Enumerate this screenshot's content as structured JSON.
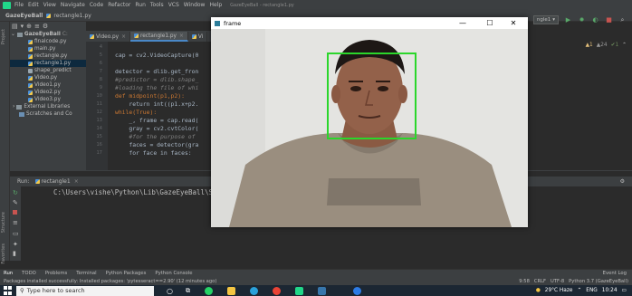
{
  "menubar": {
    "items": [
      "File",
      "Edit",
      "View",
      "Navigate",
      "Code",
      "Refactor",
      "Run",
      "Tools",
      "VCS",
      "Window",
      "Help"
    ],
    "window_title": "GazeEyeBall - rectangle1.py"
  },
  "navbar": {
    "project": "GazeEyeBall",
    "file": "rectangle1.py"
  },
  "toolbar": {
    "run_config": "ngle1"
  },
  "project_panel": {
    "header": "Project",
    "root": "GazeEyeBall",
    "root_suffix": "C:",
    "items": [
      {
        "label": "finalcode.py"
      },
      {
        "label": "main.py"
      },
      {
        "label": "rectangle.py"
      },
      {
        "label": "rectangle1.py",
        "selected": true
      },
      {
        "label": "shape_predict"
      },
      {
        "label": "Video.py"
      },
      {
        "label": "Video1.py"
      },
      {
        "label": "Video2.py"
      },
      {
        "label": "Video3.py"
      }
    ],
    "external": "External Libraries",
    "scratches": "Scratches and Co"
  },
  "tabs": [
    {
      "label": "Video.py",
      "active": false
    },
    {
      "label": "rectangle1.py",
      "active": true
    },
    {
      "label": "Vi",
      "active": false
    }
  ],
  "editor": {
    "inspections": {
      "warnings": "▲1",
      "weak": "▲24",
      "ok": "✔1"
    },
    "lines": [
      {
        "n": "4",
        "text": "",
        "kind": "normal"
      },
      {
        "n": "5",
        "text": "cap = cv2.VideoCapture(0",
        "kind": "normal"
      },
      {
        "n": "6",
        "text": "",
        "kind": "normal"
      },
      {
        "n": "7",
        "text": "detector = dlib.get_fron",
        "kind": "normal"
      },
      {
        "n": "8",
        "text": "#predictor = dlib.shape_",
        "kind": "comment"
      },
      {
        "n": "9",
        "text": "#loading the file of whi",
        "kind": "comment"
      },
      {
        "n": "10",
        "text": "def midpoint(p1,p2):",
        "kind": "keyword"
      },
      {
        "n": "11",
        "text": "    return int((p1.x+p2.",
        "kind": "normal"
      },
      {
        "n": "12",
        "text": "while(True):",
        "kind": "keyword"
      },
      {
        "n": "13",
        "text": "    _, frame = cap.read(",
        "kind": "normal"
      },
      {
        "n": "14",
        "text": "    gray = cv2.cvtColor(",
        "kind": "normal"
      },
      {
        "n": "15",
        "text": "    #for the purpose of ",
        "kind": "comment"
      },
      {
        "n": "16",
        "text": "    faces = detector(gra",
        "kind": "normal"
      },
      {
        "n": "17",
        "text": "    for face in faces:",
        "kind": "normal"
      }
    ]
  },
  "run_panel": {
    "label": "Run:",
    "config": "rectangle1",
    "console_line": "C:\\Users\\vishe\\Python\\Lib\\GazeEyeBall\\Sc"
  },
  "bottom_tabs": [
    "Run",
    "TODO",
    "Problems",
    "Terminal",
    "Python Packages",
    "Python Console"
  ],
  "event_log": "Event Log",
  "statusbar": {
    "message": "Packages installed successfully: Installed packages: 'pytesseract==2.90' (12 minutes ago)",
    "position": "9:58",
    "line_sep": "CRLF",
    "encoding": "UTF-8",
    "interpreter": "Python 3.7 (GazeEyeBall)"
  },
  "taskbar": {
    "search_placeholder": "Type here to search",
    "weather": "29°C  Haze",
    "lang": "ENG",
    "time": "10:24"
  },
  "frame_window": {
    "title": "frame",
    "minimize": "—",
    "maximize": "☐",
    "close": "✕",
    "face_detected": true
  }
}
